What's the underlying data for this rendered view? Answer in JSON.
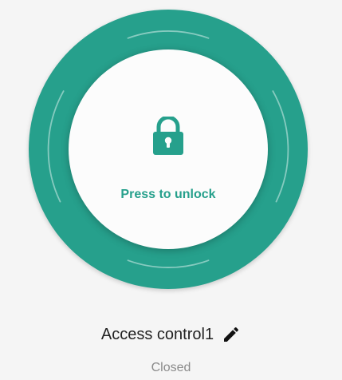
{
  "lock_panel": {
    "button_label": "Press to unlock",
    "lock_icon": "lock-icon",
    "accent_color": "#26a08c"
  },
  "device": {
    "name": "Access control1",
    "edit_icon": "pencil-icon",
    "status": "Closed"
  }
}
